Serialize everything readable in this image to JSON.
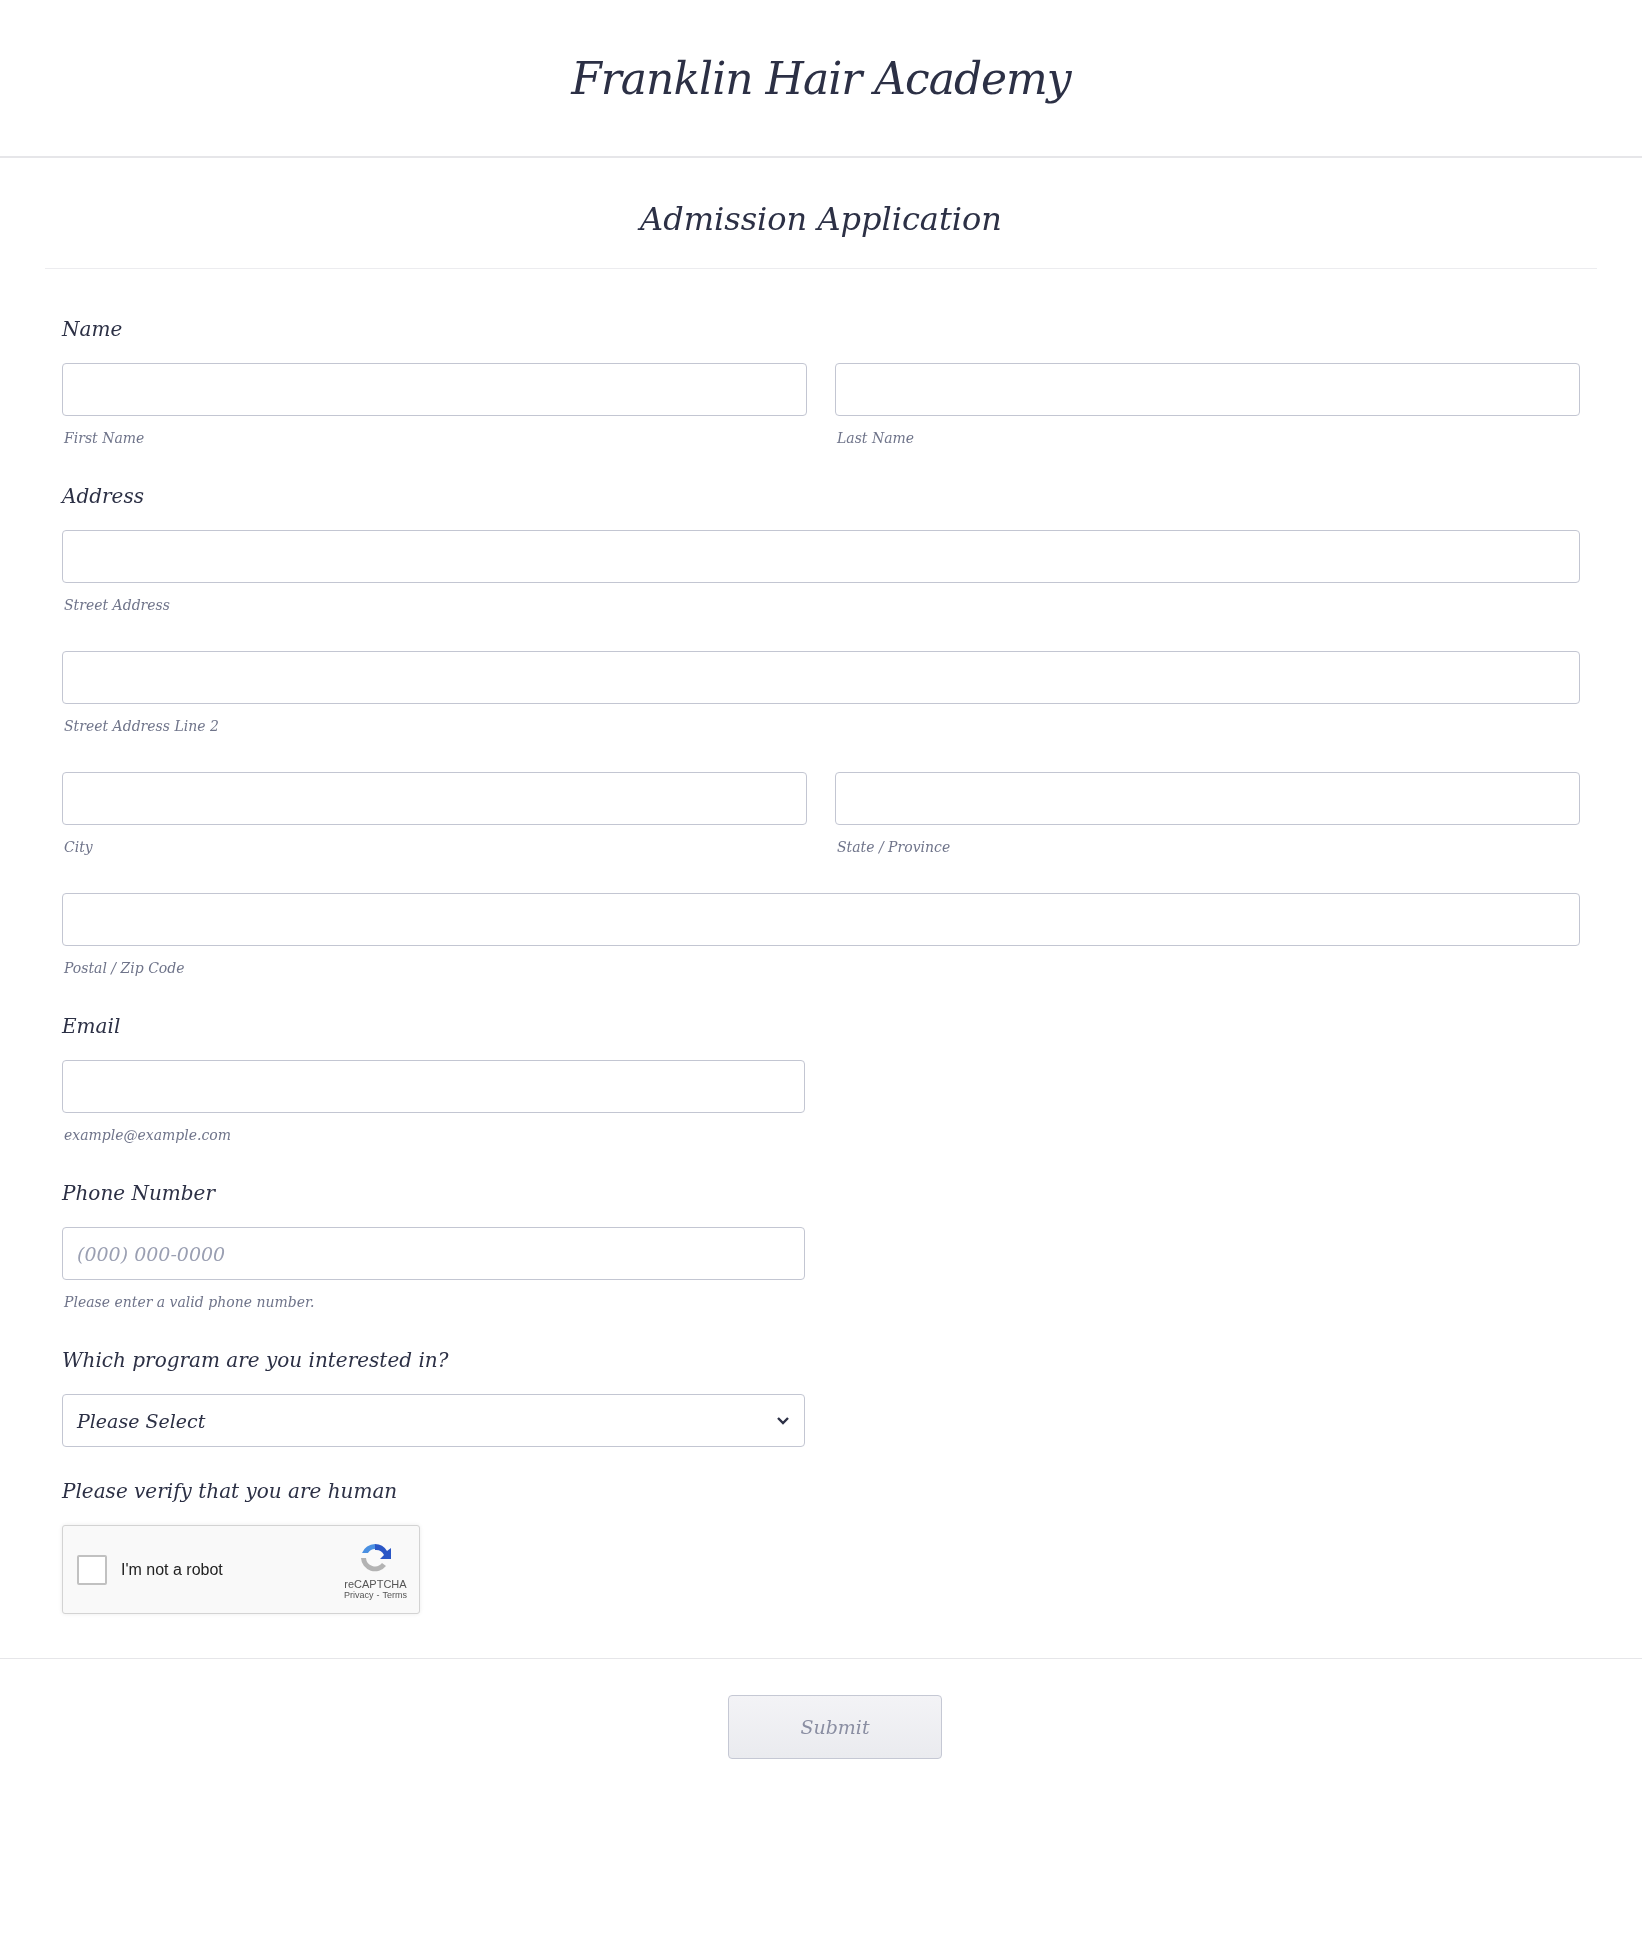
{
  "header": {
    "title": "Franklin Hair Academy"
  },
  "form_title": "Admission Application",
  "sections": [
    {
      "kind": "inputs",
      "label": "Name",
      "rows": [
        [
          {
            "sublabel": "First Name"
          },
          {
            "sublabel": "Last Name"
          }
        ]
      ]
    },
    {
      "kind": "inputs",
      "label": "Address",
      "rows": [
        [
          {
            "sublabel": "Street Address"
          }
        ],
        [
          {
            "sublabel": "Street Address Line 2"
          }
        ],
        [
          {
            "sublabel": "City"
          },
          {
            "sublabel": "State / Province"
          }
        ],
        [
          {
            "sublabel": "Postal / Zip Code"
          }
        ]
      ]
    },
    {
      "kind": "inputs",
      "label": "Email",
      "half": true,
      "rows": [
        [
          {
            "sublabel": "example@example.com"
          }
        ]
      ]
    },
    {
      "kind": "inputs",
      "label": "Phone Number",
      "half": true,
      "rows": [
        [
          {
            "placeholder": "(000) 000-0000",
            "sublabel": "Please enter a valid phone number."
          }
        ]
      ]
    },
    {
      "kind": "select",
      "label": "Which program are you interested in?",
      "value": "Please Select"
    },
    {
      "kind": "captcha",
      "label": "Please verify that you are human",
      "checkbox_label": "I'm not a robot",
      "checked": false,
      "brand": "reCAPTCHA",
      "links": [
        "Privacy",
        "Terms"
      ],
      "separator": "-"
    }
  ],
  "submit": "Submit"
}
